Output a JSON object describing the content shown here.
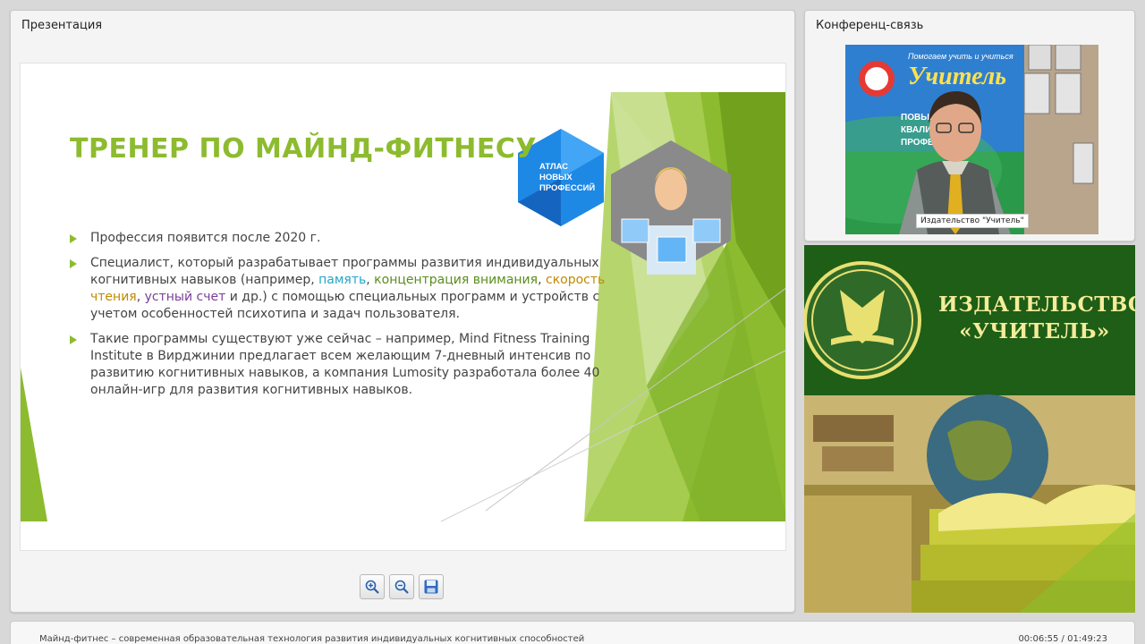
{
  "presentation_panel": {
    "title": "Презентация"
  },
  "slide": {
    "title": "ТРЕНЕР ПО МАЙНД-ФИТНЕСУ",
    "badge": [
      "АТЛАС",
      "НОВЫХ",
      "ПРОФЕССИЙ"
    ],
    "bullet1": "Профессия появится после 2020 г.",
    "bullet2": {
      "part1": "Специалист, который разрабатывает программы развития индивидуальных когнитивных навыков (например, ",
      "kw1": "память",
      "sep1": ", ",
      "kw2": "концентрация внимания",
      "sep2": ", ",
      "kw3": "скорость чтения",
      "sep3": ", ",
      "kw4": "устный счет",
      "part2": " и др.) с помощью специальных программ и устройств с учетом особенностей психотипа и задач пользователя."
    },
    "bullet3": "Такие программы существуют уже сейчас – например, Mind Fitness Training Institute в Вирджинии предлагает всем желающим 7-дневный интенсив по развитию когнитивных навыков, а компания Lumosity разработала более 40 онлайн-игр для развития когнитивных навыков.",
    "colors": {
      "accent_green": "#8dbb2f",
      "badge_blue": "#1e88e5"
    }
  },
  "toolbar": {
    "zoom_in_icon": "zoom-in-icon",
    "zoom_out_icon": "zoom-out-icon",
    "save_icon": "save-icon"
  },
  "conference_panel": {
    "title": "Конференц-связь",
    "video_caption": "Издательство \"Учитель\"",
    "poster_lines": [
      "Помогаем учить и учиться",
      "Учитель",
      "ПОВЫШЕНИЕ",
      "КВАЛИФИК",
      "ПРОФЕССИ"
    ]
  },
  "publisher_banner": {
    "name_line1": "ИЗДАТЕЛЬСТВО",
    "name_line2": "«УЧИТЕЛЬ»",
    "colors": {
      "background": "#1e5e16",
      "text": "#f5ec9a"
    }
  },
  "bottom_bar": {
    "title": "Майнд-фитнес – современная образовательная технология развития индивидуальных когнитивных способностей",
    "time": "00:06:55 / 01:49:23"
  }
}
